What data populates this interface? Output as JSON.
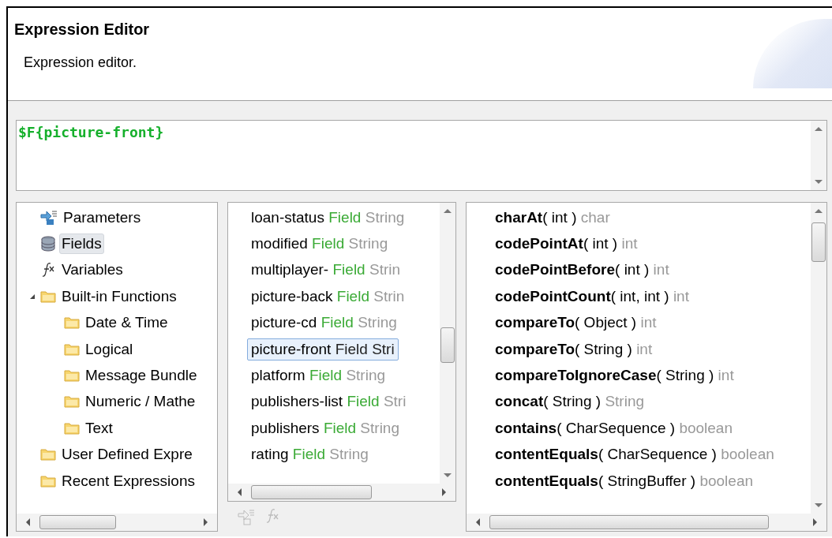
{
  "header": {
    "title": "Expression Editor",
    "description": "Expression editor."
  },
  "expression": {
    "value": "$F{picture-front}"
  },
  "tree": [
    {
      "label": "Parameters",
      "kind": "parameters",
      "selected": false
    },
    {
      "label": "Fields",
      "kind": "fields",
      "selected": true
    },
    {
      "label": "Variables",
      "kind": "variables",
      "selected": false
    },
    {
      "label": "Built-in Functions",
      "kind": "folder",
      "selected": false,
      "expanded": true,
      "children": [
        {
          "label": "Date & Time",
          "kind": "folder",
          "selected": false
        },
        {
          "label": "Logical",
          "kind": "folder",
          "selected": false
        },
        {
          "label": "Message Bundle",
          "kind": "folder",
          "selected": false
        },
        {
          "label": "Numeric / Mathe",
          "kind": "folder",
          "selected": false
        },
        {
          "label": "Text",
          "kind": "folder",
          "selected": false
        }
      ]
    },
    {
      "label": "User Defined Expre",
      "kind": "folder",
      "selected": false
    },
    {
      "label": "Recent Expressions",
      "kind": "folder",
      "selected": false
    }
  ],
  "fields": [
    {
      "name": "loan-status",
      "type": "Field",
      "datatype": "String",
      "selected": false
    },
    {
      "name": "modified",
      "type": "Field",
      "datatype": "String",
      "selected": false
    },
    {
      "name": "multiplayer-",
      "type": "Field",
      "datatype": "Strin",
      "selected": false
    },
    {
      "name": "picture-back",
      "type": "Field",
      "datatype": "Strin",
      "selected": false
    },
    {
      "name": "picture-cd",
      "type": "Field",
      "datatype": "String",
      "selected": false
    },
    {
      "name": "picture-front",
      "type": "Field",
      "datatype": "Stri",
      "selected": true
    },
    {
      "name": "platform",
      "type": "Field",
      "datatype": "String",
      "selected": false
    },
    {
      "name": "publishers-list",
      "type": "Field",
      "datatype": "Stri",
      "selected": false
    },
    {
      "name": "publishers",
      "type": "Field",
      "datatype": "String",
      "selected": false
    },
    {
      "name": "rating",
      "type": "Field",
      "datatype": "String",
      "selected": false
    }
  ],
  "functions": [
    {
      "name": "charAt",
      "params": "( int )",
      "returns": "char"
    },
    {
      "name": "codePointAt",
      "params": "( int )",
      "returns": "int"
    },
    {
      "name": "codePointBefore",
      "params": "( int )",
      "returns": "int"
    },
    {
      "name": "codePointCount",
      "params": "( int, int )",
      "returns": "int"
    },
    {
      "name": "compareTo",
      "params": "( Object )",
      "returns": "int"
    },
    {
      "name": "compareTo",
      "params": "( String )",
      "returns": "int"
    },
    {
      "name": "compareToIgnoreCase",
      "params": "( String )",
      "returns": "int"
    },
    {
      "name": "concat",
      "params": "( String )",
      "returns": "String"
    },
    {
      "name": "contains",
      "params": "( CharSequence )",
      "returns": "boolean"
    },
    {
      "name": "contentEquals",
      "params": "( CharSequence )",
      "returns": "boolean"
    },
    {
      "name": "contentEquals",
      "params": "( StringBuffer )",
      "returns": "boolean"
    }
  ]
}
